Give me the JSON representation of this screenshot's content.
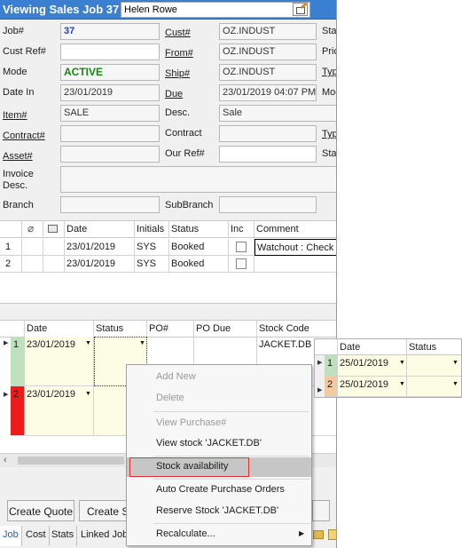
{
  "window": {
    "title": "Viewing Sales Job 37",
    "employee": "Helen Rowe"
  },
  "form": {
    "job_label": "Job#",
    "job_value": "37",
    "cust_label": "Cust#",
    "cust_value": "OZ.INDUST",
    "sta_label": "Sta",
    "custref_label": "Cust Ref#",
    "custref_value": "",
    "from_label": "From#",
    "from_value": "OZ.INDUST",
    "pric_label": "Pric",
    "mode_label": "Mode",
    "mode_value": "ACTIVE",
    "ship_label": "Ship#",
    "ship_value": "OZ.INDUST",
    "typ_label": "Typ",
    "datein_label": "Date In",
    "datein_value": "23/01/2019",
    "due_label": "Due",
    "due_value": "23/01/2019 04:07 PM",
    "moc_label": "Moc",
    "item_label": "Item#",
    "item_value": "SALE",
    "desc_label": "Desc.",
    "desc_value": "Sale",
    "contract1_label": "Contract#",
    "contract1_value": "",
    "contract2_label": "Contract",
    "contract2_value": "",
    "typ2_label": "Typ",
    "asset_label": "Asset#",
    "asset_value": "",
    "ourref_label": "Our Ref#",
    "ourref_value": "",
    "sta2_label": "Sta",
    "invoice_label_1": "Invoice",
    "invoice_label_2": "Desc.",
    "invoice_value": "",
    "branch_label": "Branch",
    "branch_value": "",
    "subbranch_label": "SubBranch",
    "subbranch_value": ""
  },
  "schedule": {
    "headers": [
      "",
      "",
      "",
      "Date",
      "Initials",
      "Status",
      "Inc",
      "Comment"
    ],
    "rows": [
      {
        "num": "1",
        "date": "23/01/2019",
        "initials": "SYS",
        "status": "Booked",
        "comment": "Watchout : Check"
      },
      {
        "num": "2",
        "date": "23/01/2019",
        "initials": "SYS",
        "status": "Booked",
        "comment": ""
      }
    ]
  },
  "stock_grid": {
    "headers": [
      "Date",
      "Status",
      "PO#",
      "PO Due",
      "Stock Code"
    ],
    "rows": [
      {
        "num": "1",
        "date": "23/01/2019",
        "stock_code": "JACKET.DB",
        "color": "#bfe0bf"
      },
      {
        "num": "2",
        "date": "23/01/2019",
        "stock_code": "",
        "color": "#ee1b1b"
      }
    ]
  },
  "side_panel": {
    "headers": [
      "Date",
      "Status"
    ],
    "rows": [
      {
        "num": "1",
        "date": "25/01/2019",
        "color": "#bfe0bf"
      },
      {
        "num": "2",
        "date": "25/01/2019",
        "color": "#f3c9a0"
      }
    ]
  },
  "context_menu": {
    "items": [
      {
        "label": "Add New",
        "enabled": false
      },
      {
        "label": "Delete",
        "enabled": false
      },
      {
        "label": "View Purchase#",
        "enabled": false
      },
      {
        "label": "View stock 'JACKET.DB'",
        "enabled": true
      },
      {
        "label": "Stock availability",
        "enabled": true,
        "selected": true
      },
      {
        "label": "Auto Create Purchase Orders",
        "enabled": true
      },
      {
        "label": "Reserve Stock 'JACKET.DB'",
        "enabled": true
      },
      {
        "label": "Recalculate...",
        "enabled": true
      }
    ]
  },
  "buttons": {
    "create_quote": "Create Quote",
    "create_s": "Create S"
  },
  "tabs": [
    "Job",
    "Cost",
    "Stats",
    "Linked Job"
  ],
  "colors": {
    "titlebar": "#3a7fd0",
    "accent": "#1e5fb8",
    "highlight_outline": "#e03030",
    "active_mode": "#128a12"
  }
}
